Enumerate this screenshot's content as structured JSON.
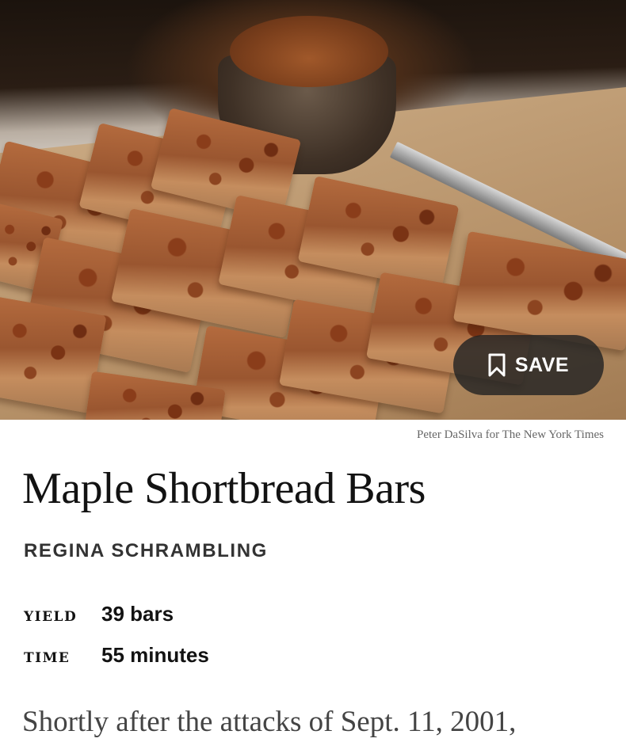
{
  "hero": {
    "save_label": "SAVE",
    "photo_credit": "Peter DaSilva for The New York Times"
  },
  "recipe": {
    "title": "Maple Shortbread Bars",
    "author": "REGINA SCHRAMBLING",
    "yield_label": "YIELD",
    "yield_value": "39 bars",
    "time_label": "TIME",
    "time_value": "55 minutes",
    "intro": "Shortly after the attacks of Sept. 11, 2001,"
  },
  "icons": {
    "save": "bookmark-icon"
  },
  "colors": {
    "save_button_bg": "#232323",
    "text_primary": "#121212",
    "text_secondary": "#666666"
  }
}
